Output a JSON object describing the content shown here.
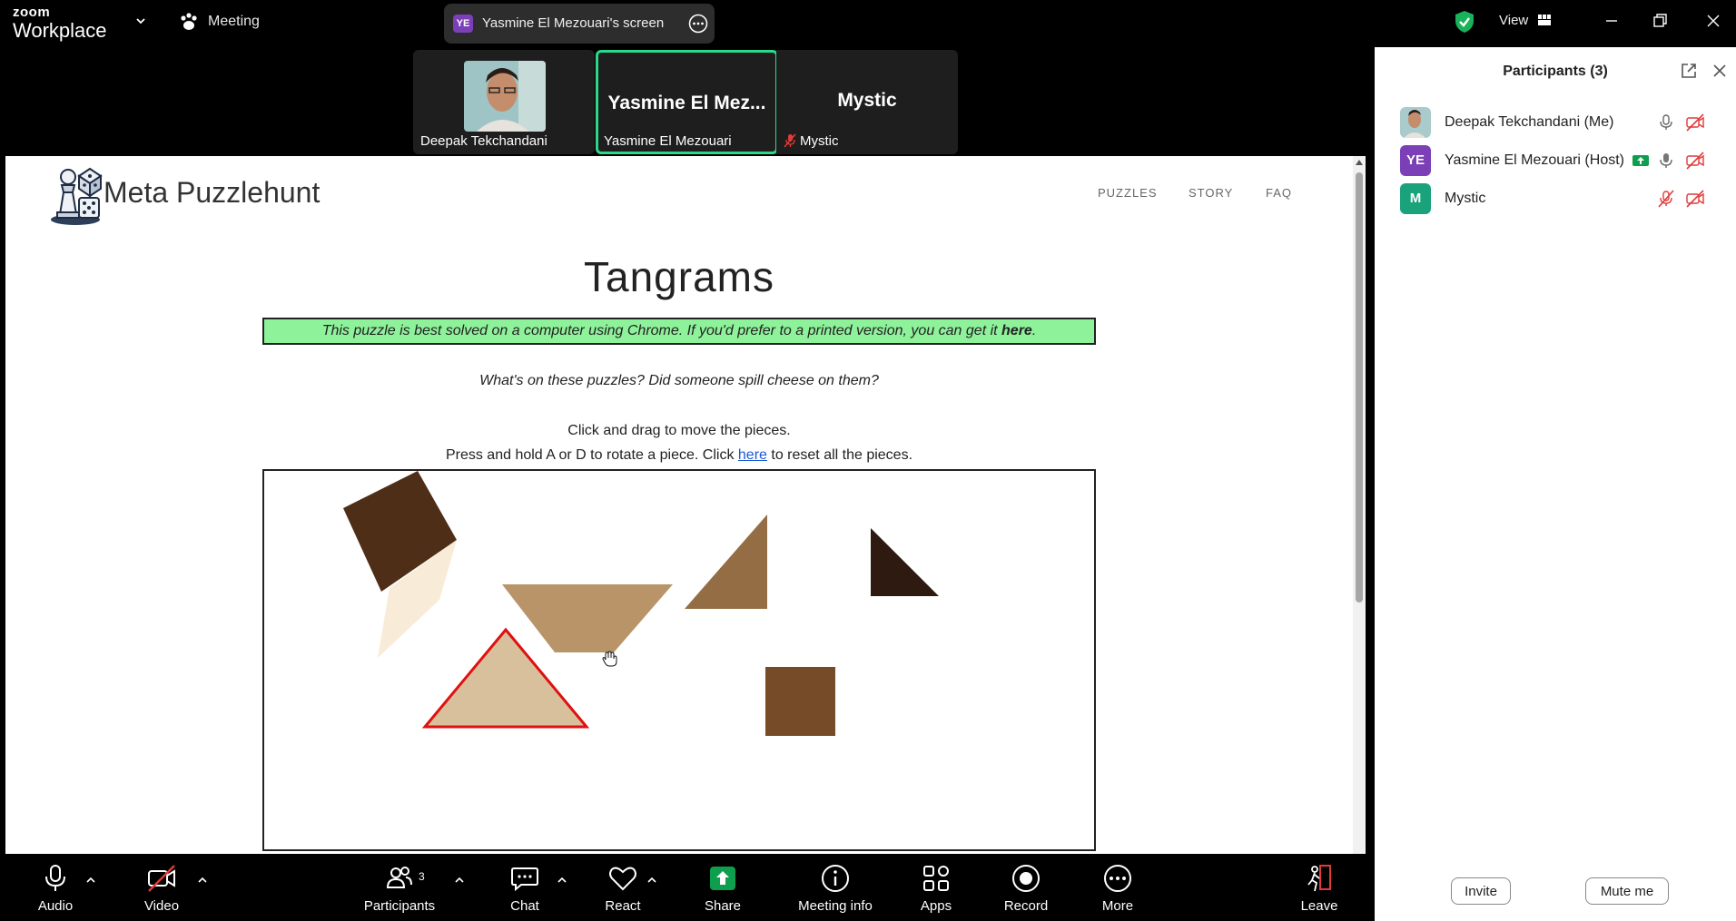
{
  "titlebar": {
    "brand_small": "zoom",
    "brand_large": "Workplace",
    "meeting_label": "Meeting",
    "screen_badge": "YE",
    "screen_label": "Yasmine El Mezouari's screen",
    "view_label": "View"
  },
  "video_strip": {
    "tiles": [
      {
        "name": "Deepak Tekchandani",
        "big": ""
      },
      {
        "name": "Yasmine El Mezouari",
        "big": "Yasmine  El  Mez..."
      },
      {
        "name": "Mystic",
        "big": "Mystic"
      }
    ],
    "active_tile": "Yasmine El Mezouari"
  },
  "shared_page": {
    "site_title": "Meta Puzzlehunt",
    "nav": [
      "PUZZLES",
      "STORY",
      "FAQ"
    ],
    "heading": "Tangrams",
    "banner_text": "This puzzle is best solved on a computer using Chrome. If you'd prefer to a printed version, you can get it ",
    "banner_link": "here",
    "banner_end": ".",
    "flavor": "What's on these puzzles? Did someone spill cheese on them?",
    "instruction_1": "Click and drag to move the pieces.",
    "instruction_2_pre": "Press and hold A or D to rotate a piece. Click ",
    "instruction_2_link": "here",
    "instruction_2_post": " to reset all the pieces.",
    "pieces": [
      {
        "shape": "square",
        "color": "#4f2e17"
      },
      {
        "shape": "parallelogram",
        "color": "#f8ecd8"
      },
      {
        "shape": "trapezoid",
        "color": "#b89468"
      },
      {
        "shape": "triangle",
        "color": "#946d44"
      },
      {
        "shape": "triangle",
        "color": "#2e1a10"
      },
      {
        "shape": "triangle",
        "color": "#d9c09c",
        "selected": true
      },
      {
        "shape": "square",
        "color": "#764c28"
      }
    ]
  },
  "participants_panel": {
    "title": "Participants (3)",
    "participants": [
      {
        "name": "Deepak Tekchandani (Me)",
        "initials": "",
        "avatar_color": "#c9a98a",
        "mic": "on",
        "video": "off"
      },
      {
        "name": "Yasmine El Mezouari (Host)",
        "initials": "YE",
        "avatar_color": "#7b3fb8",
        "mic": "on",
        "video": "off",
        "sharing": true
      },
      {
        "name": "Mystic",
        "initials": "M",
        "avatar_color": "#1aa37a",
        "mic": "muted",
        "video": "off"
      }
    ],
    "invite_label": "Invite",
    "mute_me_label": "Mute me"
  },
  "toolbar": {
    "audio": "Audio",
    "video": "Video",
    "participants": "Participants",
    "participants_count": "3",
    "chat": "Chat",
    "react": "React",
    "share": "Share",
    "meeting_info": "Meeting info",
    "apps": "Apps",
    "record": "Record",
    "more": "More",
    "leave": "Leave"
  },
  "colors": {
    "share_green": "#0e9f4e",
    "active_tile_border": "#2bd98a",
    "banner_bg": "#8ef29a",
    "muted_red": "#e03a3a",
    "selected_outline": "#e01010"
  }
}
